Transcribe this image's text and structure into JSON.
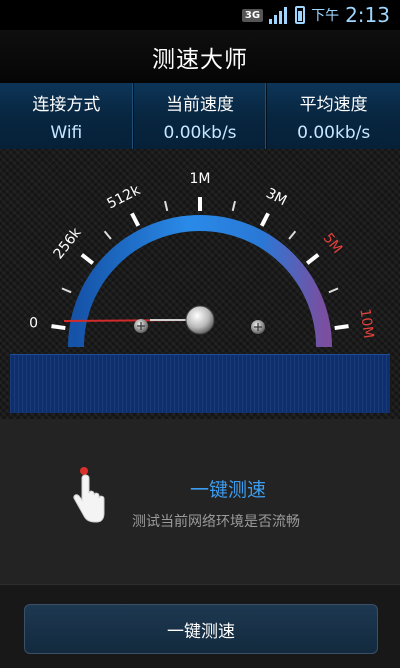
{
  "status_bar": {
    "network_type": "3G",
    "time_period": "下午",
    "time": "2:13",
    "icons": [
      "signal-icon",
      "battery-icon"
    ]
  },
  "header": {
    "title": "测速大师"
  },
  "info": {
    "items": [
      {
        "label": "连接方式",
        "value": "Wifi"
      },
      {
        "label": "当前速度",
        "value": "0.00kb/s"
      },
      {
        "label": "平均速度",
        "value": "0.00kb/s"
      }
    ]
  },
  "gauge": {
    "tick_labels": [
      "0",
      "256k",
      "512k",
      "1M",
      "3M",
      "5M",
      "10M"
    ],
    "current_speed_kbps": 0,
    "needle_value": "0",
    "colors": {
      "arc_start": "#1a73d9",
      "arc_end": "#7b4fa0",
      "needle": "#d12b2b",
      "high_label": "#e0413b"
    }
  },
  "prompt": {
    "title": "一键测速",
    "subtitle": "测试当前网络环境是否流畅",
    "icon": "tap-hand-icon"
  },
  "action": {
    "button_label": "一键测速"
  },
  "colors": {
    "accent": "#3d9cf0",
    "info_bg": "#0d3558",
    "speed_bar": "#0d2f6f"
  }
}
